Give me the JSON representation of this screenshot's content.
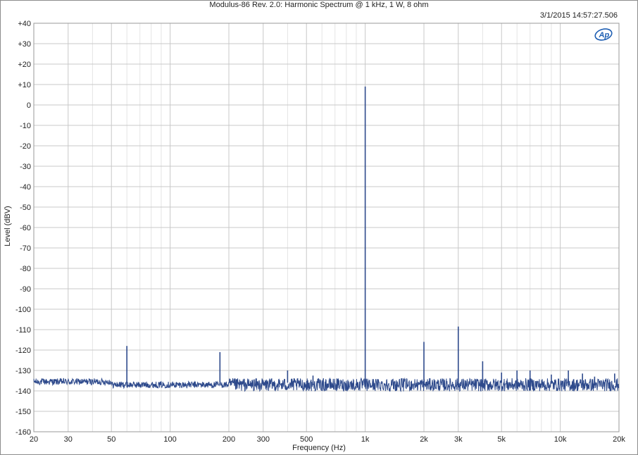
{
  "chart_data": {
    "type": "line",
    "title": "Modulus-86 Rev. 2.0: Harmonic Spectrum @ 1 kHz, 1 W, 8 ohm",
    "timestamp": "3/1/2015 14:57:27.506",
    "xlabel": "Frequency (Hz)",
    "ylabel": "Level (dBV)",
    "x_scale": "log",
    "xlim": [
      20,
      20000
    ],
    "ylim": [
      -160,
      40
    ],
    "grid": true,
    "x_tick_values": [
      20,
      30,
      50,
      100,
      200,
      300,
      500,
      1000,
      2000,
      3000,
      5000,
      10000,
      20000
    ],
    "x_tick_labels": [
      "20",
      "30",
      "50",
      "100",
      "200",
      "300",
      "500",
      "1k",
      "2k",
      "3k",
      "5k",
      "10k",
      "20k"
    ],
    "y_tick_values": [
      40,
      30,
      20,
      10,
      0,
      -10,
      -20,
      -30,
      -40,
      -50,
      -60,
      -70,
      -80,
      -90,
      -100,
      -110,
      -120,
      -130,
      -140,
      -150,
      -160
    ],
    "y_tick_labels": [
      "+40",
      "+30",
      "+20",
      "+10",
      "0",
      "-10",
      "-20",
      "-30",
      "-40",
      "-50",
      "-60",
      "-70",
      "-80",
      "-90",
      "-100",
      "-110",
      "-120",
      "-130",
      "-140",
      "-150",
      "-160"
    ],
    "series": [
      {
        "color": "#2e4a8c",
        "noise_floor": -137,
        "noise_floor_low_freq": -135.5,
        "peaks": [
          {
            "x": 60,
            "y": -118
          },
          {
            "x": 180,
            "y": -121
          },
          {
            "x": 400,
            "y": -130
          },
          {
            "x": 540,
            "y": -132.5
          },
          {
            "x": 1000,
            "y": 9
          },
          {
            "x": 2000,
            "y": -116
          },
          {
            "x": 3000,
            "y": -108.5
          },
          {
            "x": 4000,
            "y": -125.5
          },
          {
            "x": 5000,
            "y": -131
          },
          {
            "x": 6000,
            "y": -130
          },
          {
            "x": 7000,
            "y": -130
          },
          {
            "x": 9000,
            "y": -132
          },
          {
            "x": 11000,
            "y": -130
          },
          {
            "x": 13000,
            "y": -131.5
          },
          {
            "x": 15000,
            "y": -133
          },
          {
            "x": 19000,
            "y": -131.5
          }
        ]
      }
    ]
  },
  "logo": {
    "text": "Ap",
    "color": "#1f5fb3"
  }
}
